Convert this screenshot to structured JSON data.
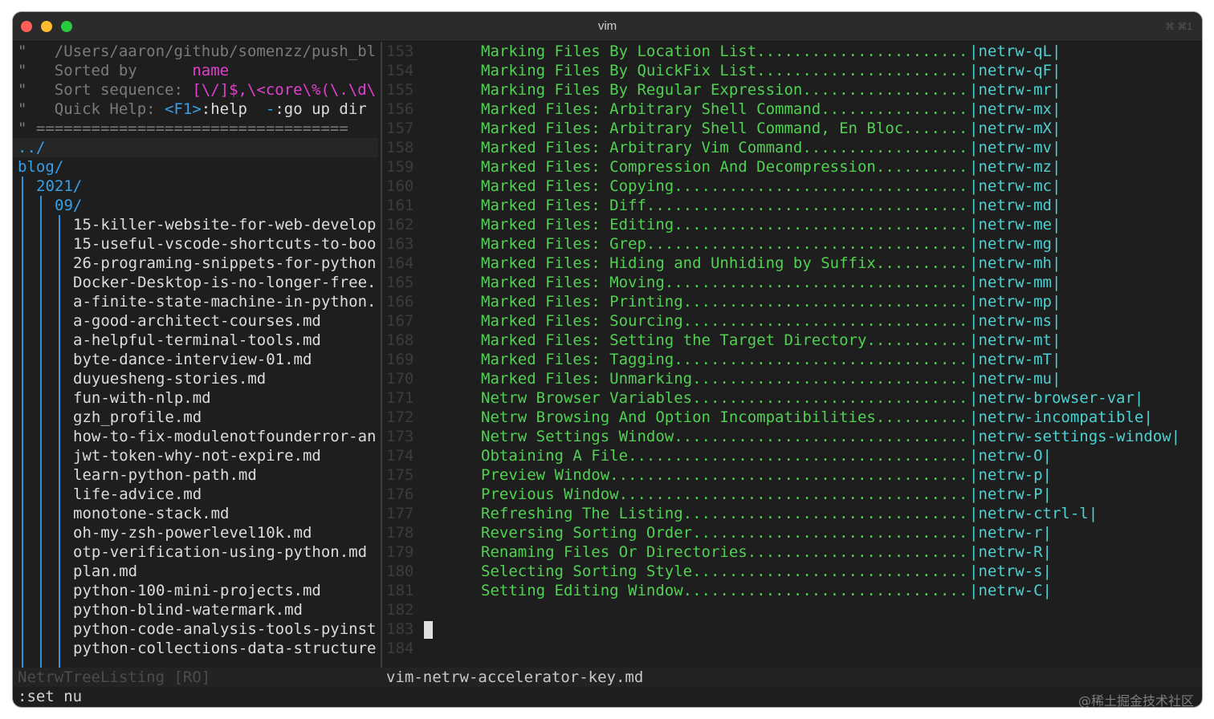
{
  "window": {
    "title": "vim",
    "shortcut": "⌘ ⌘1"
  },
  "netrw_header": {
    "line1": "\"   /Users/aaron/github/somenzz/push_bl",
    "line2_prefix": "\"   Sorted by      ",
    "line2_value": "name",
    "line3_prefix": "\"   Sort sequence: ",
    "line3_value": "[\\/]$,\\<core\\%(\\.\\d\\",
    "line4_prefix": "\"   Quick Help: ",
    "line4_key1": "<F1>",
    "line4_mid": ":help  ",
    "line4_key2": "-",
    "line4_end": ":go up dir",
    "line5": "\" =================================="
  },
  "tree": {
    "parent": "../",
    "blog": "blog/",
    "year": "2021/",
    "month": "09/",
    "files": [
      "15-killer-website-for-web-develop",
      "15-useful-vscode-shortcuts-to-boo",
      "26-programing-snippets-for-python",
      "Docker-Desktop-is-no-longer-free.",
      "a-finite-state-machine-in-python.",
      "a-good-architect-courses.md",
      "a-helpful-terminal-tools.md",
      "byte-dance-interview-01.md",
      "duyuesheng-stories.md",
      "fun-with-nlp.md",
      "gzh_profile.md",
      "how-to-fix-modulenotfounderror-an",
      "jwt-token-why-not-expire.md",
      "learn-python-path.md",
      "life-advice.md",
      "monotone-stack.md",
      "oh-my-zsh-powerlevel10k.md",
      "otp-verification-using-python.md",
      "plan.md",
      "python-100-mini-projects.md",
      "python-blind-watermark.md",
      "python-code-analysis-tools-pyinst",
      "python-collections-data-structure"
    ]
  },
  "help_lines": [
    {
      "num": "153",
      "topic": "Marking Files By Location List.......................",
      "tag": "|netrw-qL|"
    },
    {
      "num": "154",
      "topic": "Marking Files By QuickFix List.......................",
      "tag": "|netrw-qF|"
    },
    {
      "num": "155",
      "topic": "Marking Files By Regular Expression..................",
      "tag": "|netrw-mr|"
    },
    {
      "num": "156",
      "topic": "Marked Files: Arbitrary Shell Command................",
      "tag": "|netrw-mx|"
    },
    {
      "num": "157",
      "topic": "Marked Files: Arbitrary Shell Command, En Bloc.......",
      "tag": "|netrw-mX|"
    },
    {
      "num": "158",
      "topic": "Marked Files: Arbitrary Vim Command..................",
      "tag": "|netrw-mv|"
    },
    {
      "num": "159",
      "topic": "Marked Files: Compression And Decompression..........",
      "tag": "|netrw-mz|"
    },
    {
      "num": "160",
      "topic": "Marked Files: Copying................................",
      "tag": "|netrw-mc|"
    },
    {
      "num": "161",
      "topic": "Marked Files: Diff...................................",
      "tag": "|netrw-md|"
    },
    {
      "num": "162",
      "topic": "Marked Files: Editing................................",
      "tag": "|netrw-me|"
    },
    {
      "num": "163",
      "topic": "Marked Files: Grep...................................",
      "tag": "|netrw-mg|"
    },
    {
      "num": "164",
      "topic": "Marked Files: Hiding and Unhiding by Suffix..........",
      "tag": "|netrw-mh|"
    },
    {
      "num": "165",
      "topic": "Marked Files: Moving.................................",
      "tag": "|netrw-mm|"
    },
    {
      "num": "166",
      "topic": "Marked Files: Printing...............................",
      "tag": "|netrw-mp|"
    },
    {
      "num": "167",
      "topic": "Marked Files: Sourcing...............................",
      "tag": "|netrw-ms|"
    },
    {
      "num": "168",
      "topic": "Marked Files: Setting the Target Directory...........",
      "tag": "|netrw-mt|"
    },
    {
      "num": "169",
      "topic": "Marked Files: Tagging................................",
      "tag": "|netrw-mT|"
    },
    {
      "num": "170",
      "topic": "Marked Files: Unmarking..............................",
      "tag": "|netrw-mu|"
    },
    {
      "num": "171",
      "topic": "Netrw Browser Variables..............................",
      "tag": "|netrw-browser-var|"
    },
    {
      "num": "172",
      "topic": "Netrw Browsing And Option Incompatibilities..........",
      "tag": "|netrw-incompatible|"
    },
    {
      "num": "173",
      "topic": "Netrw Settings Window................................",
      "tag": "|netrw-settings-window|"
    },
    {
      "num": "174",
      "topic": "Obtaining A File.....................................",
      "tag": "|netrw-O|"
    },
    {
      "num": "175",
      "topic": "Preview Window.......................................",
      "tag": "|netrw-p|"
    },
    {
      "num": "176",
      "topic": "Previous Window......................................",
      "tag": "|netrw-P|"
    },
    {
      "num": "177",
      "topic": "Refreshing The Listing...............................",
      "tag": "|netrw-ctrl-l|"
    },
    {
      "num": "178",
      "topic": "Reversing Sorting Order..............................",
      "tag": "|netrw-r|"
    },
    {
      "num": "179",
      "topic": "Renaming Files Or Directories........................",
      "tag": "|netrw-R|"
    },
    {
      "num": "180",
      "topic": "Selecting Sorting Style..............................",
      "tag": "|netrw-s|"
    },
    {
      "num": "181",
      "topic": "Setting Editing Window...............................",
      "tag": "|netrw-C|"
    },
    {
      "num": "182",
      "topic": "",
      "tag": ""
    },
    {
      "num": "183",
      "topic": "",
      "tag": ""
    },
    {
      "num": "184",
      "topic": "",
      "tag": ""
    }
  ],
  "status": {
    "left": "NetrwTreeListing [RO]",
    "right": "vim-netrw-accelerator-key.md"
  },
  "cmdline": ":set nu",
  "watermark": "@稀土掘金技术社区",
  "colors": {
    "green": "#52d053",
    "cyan": "#4fd0d0",
    "blue": "#39a0e8",
    "magenta": "#e040d0"
  }
}
